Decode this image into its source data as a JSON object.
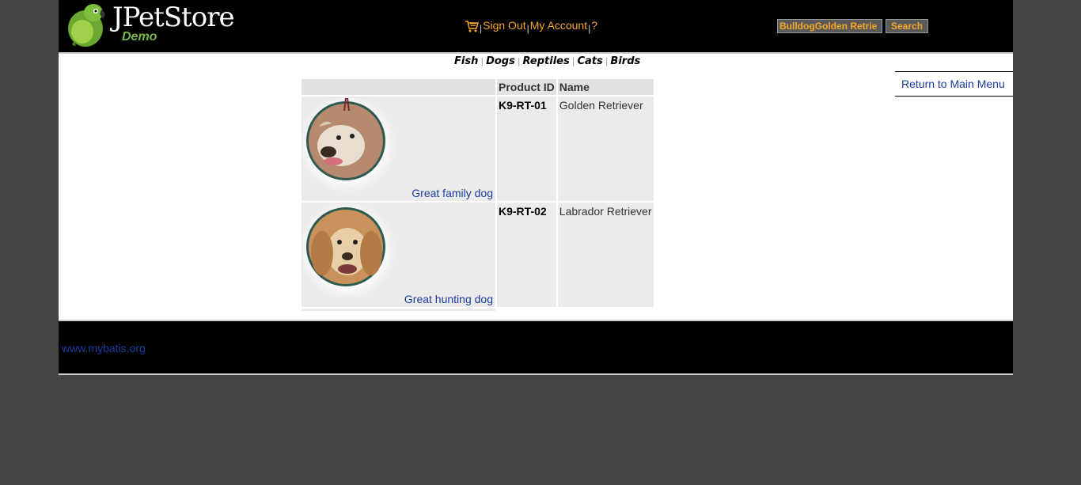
{
  "header": {
    "logo_title": "JPetStore",
    "logo_subtitle": "Demo",
    "menu": {
      "cart_icon": "cart-icon",
      "sign_out": "Sign Out",
      "my_account": "My Account",
      "help": "?",
      "separator": "|"
    },
    "search": {
      "value": "BulldogGolden Retrie",
      "button_label": "Search"
    }
  },
  "quicklinks": [
    "Fish",
    "Dogs",
    "Reptiles",
    "Cats",
    "Birds"
  ],
  "sidebar": {
    "return_label": "Return to Main Menu"
  },
  "table": {
    "columns": [
      "",
      "Product ID",
      "Name"
    ],
    "rows": [
      {
        "description": "Great family dog",
        "product_id": "K9-RT-01",
        "name": "Golden Retriever"
      },
      {
        "description": "Great hunting dog",
        "product_id": "K9-RT-02",
        "name": "Labrador Retriever"
      }
    ]
  },
  "footer": {
    "link": "www.mybatis.org"
  },
  "colors": {
    "page_bg": "#444444",
    "header_bg": "#000000",
    "menu_link": "#f5a623",
    "content_link": "#1a3c9e",
    "logo_sub": "#7ab648"
  }
}
